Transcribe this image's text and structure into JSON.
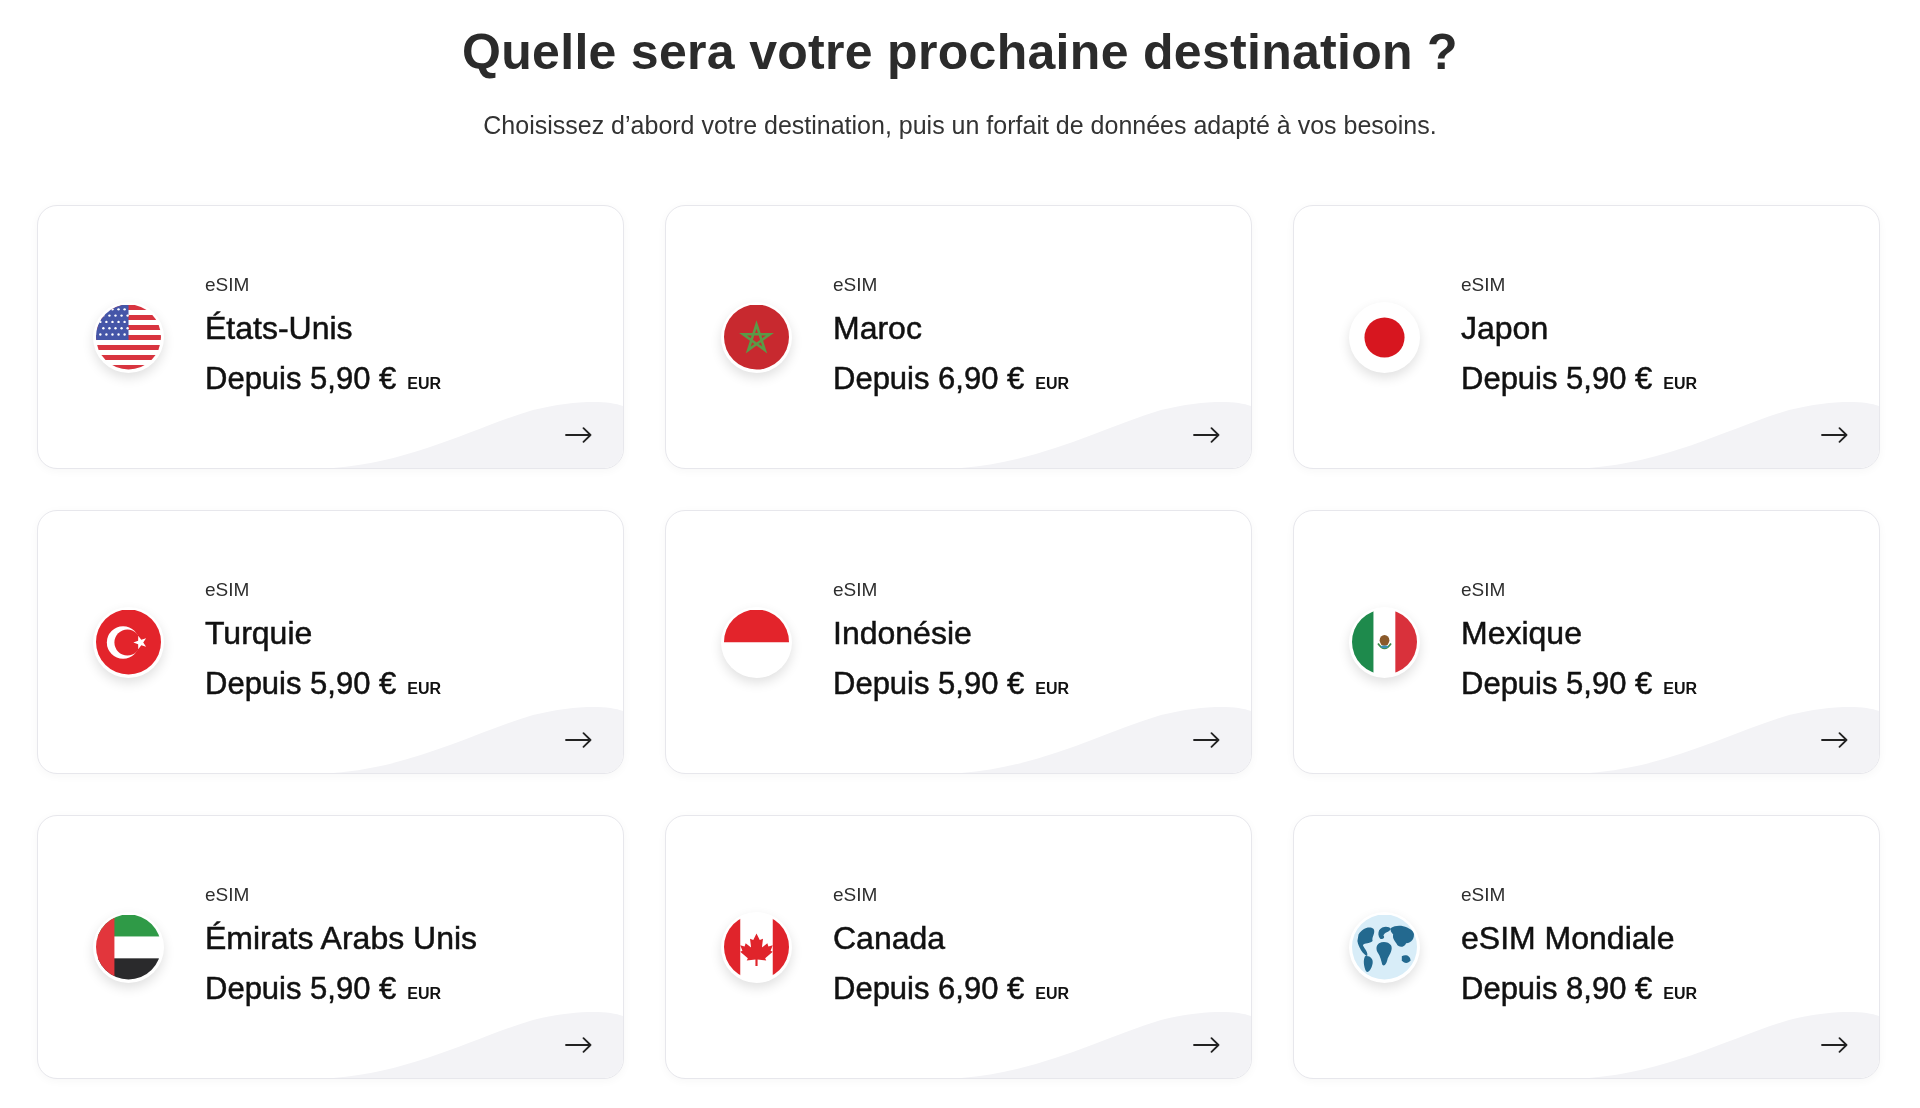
{
  "heading": {
    "title": "Quelle sera votre prochaine destination ?",
    "subtitle": "Choisissez d’abord votre destination, puis un forfait de données adapté à vos besoins."
  },
  "destinations": [
    {
      "kind": "usa",
      "label": "eSIM",
      "name": "États-Unis",
      "price": "Depuis 5,90 €",
      "currency": "EUR"
    },
    {
      "kind": "morocco",
      "label": "eSIM",
      "name": "Maroc",
      "price": "Depuis 6,90 €",
      "currency": "EUR"
    },
    {
      "kind": "japan",
      "label": "eSIM",
      "name": "Japon",
      "price": "Depuis 5,90 €",
      "currency": "EUR"
    },
    {
      "kind": "turkey",
      "label": "eSIM",
      "name": "Turquie",
      "price": "Depuis 5,90 €",
      "currency": "EUR"
    },
    {
      "kind": "indonesia",
      "label": "eSIM",
      "name": "Indonésie",
      "price": "Depuis 5,90 €",
      "currency": "EUR"
    },
    {
      "kind": "mexico",
      "label": "eSIM",
      "name": "Mexique",
      "price": "Depuis 5,90 €",
      "currency": "EUR"
    },
    {
      "kind": "uae",
      "label": "eSIM",
      "name": "Émirats Arabs Unis",
      "price": "Depuis 5,90 €",
      "currency": "EUR"
    },
    {
      "kind": "canada",
      "label": "eSIM",
      "name": "Canada",
      "price": "Depuis 6,90 €",
      "currency": "EUR"
    },
    {
      "kind": "globe",
      "label": "eSIM",
      "name": "eSIM Mondiale",
      "price": "Depuis 8,90 €",
      "currency": "EUR"
    }
  ]
}
